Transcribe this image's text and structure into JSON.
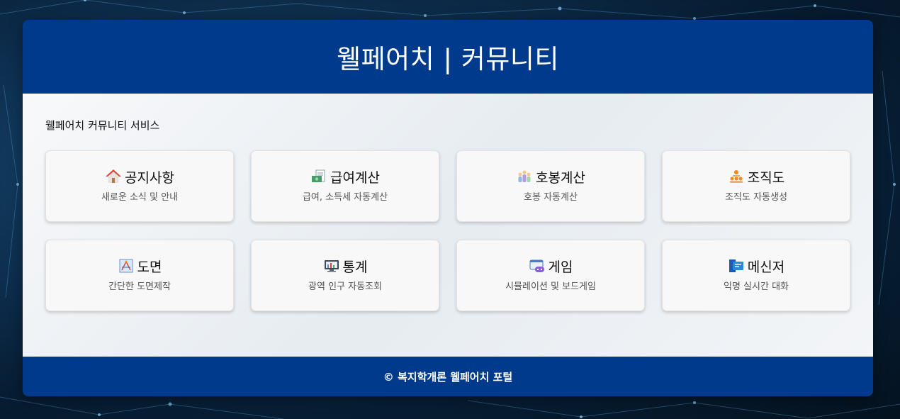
{
  "header": {
    "title": "웰페어치 | 커뮤니티"
  },
  "main": {
    "section_title": "웰페어치 커뮤니티 서비스",
    "cards": [
      {
        "icon": "house-icon",
        "title": "공지사항",
        "subtitle": "새로운 소식 및 안내"
      },
      {
        "icon": "money-receipt-icon",
        "title": "급여계산",
        "subtitle": "급여, 소득세 자동계산"
      },
      {
        "icon": "people-group-icon",
        "title": "호봉계산",
        "subtitle": "호봉 자동계산"
      },
      {
        "icon": "org-chart-icon",
        "title": "조직도",
        "subtitle": "조직도 자동생성"
      },
      {
        "icon": "blueprint-icon",
        "title": "도면",
        "subtitle": "간단한 도면제작"
      },
      {
        "icon": "stats-monitor-icon",
        "title": "통계",
        "subtitle": "광역 인구 자동조회"
      },
      {
        "icon": "game-controller-icon",
        "title": "게임",
        "subtitle": "시뮬레이션 및 보드게임"
      },
      {
        "icon": "messenger-icon",
        "title": "메신저",
        "subtitle": "익명 실시간 대화"
      }
    ]
  },
  "footer": {
    "text": "© 복지학개론 웰페어치 포털"
  },
  "colors": {
    "header_bg": "#003a8c",
    "footer_bg": "#003a8c",
    "card_bg": "#f8f8f8",
    "main_bg": "#eef1f4"
  }
}
